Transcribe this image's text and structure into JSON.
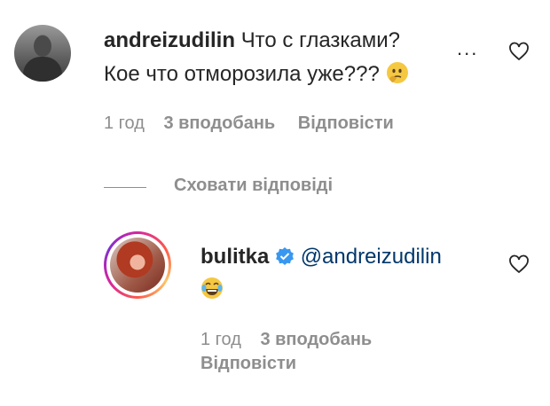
{
  "comment1": {
    "username": "andreizudilin",
    "text_line1": "Что с глазками?",
    "text_line2": "Кое что отморозила уже???",
    "emoji": "thinking-face-emoji",
    "time": "1 год",
    "likes": "3 вподобань",
    "reply_label": "Відповісти",
    "more_label": "..."
  },
  "hide_replies": {
    "label": "Сховати відповіді"
  },
  "reply1": {
    "username": "bulitka",
    "mention": "@andreizudilin",
    "emoji": "joy-face-emoji",
    "time": "1 год",
    "likes": "3 вподобань",
    "reply_label": "Відповісти"
  },
  "colors": {
    "text": "#262626",
    "meta": "#8e8e8e",
    "mention": "#00376b",
    "verified": "#3897f0"
  }
}
